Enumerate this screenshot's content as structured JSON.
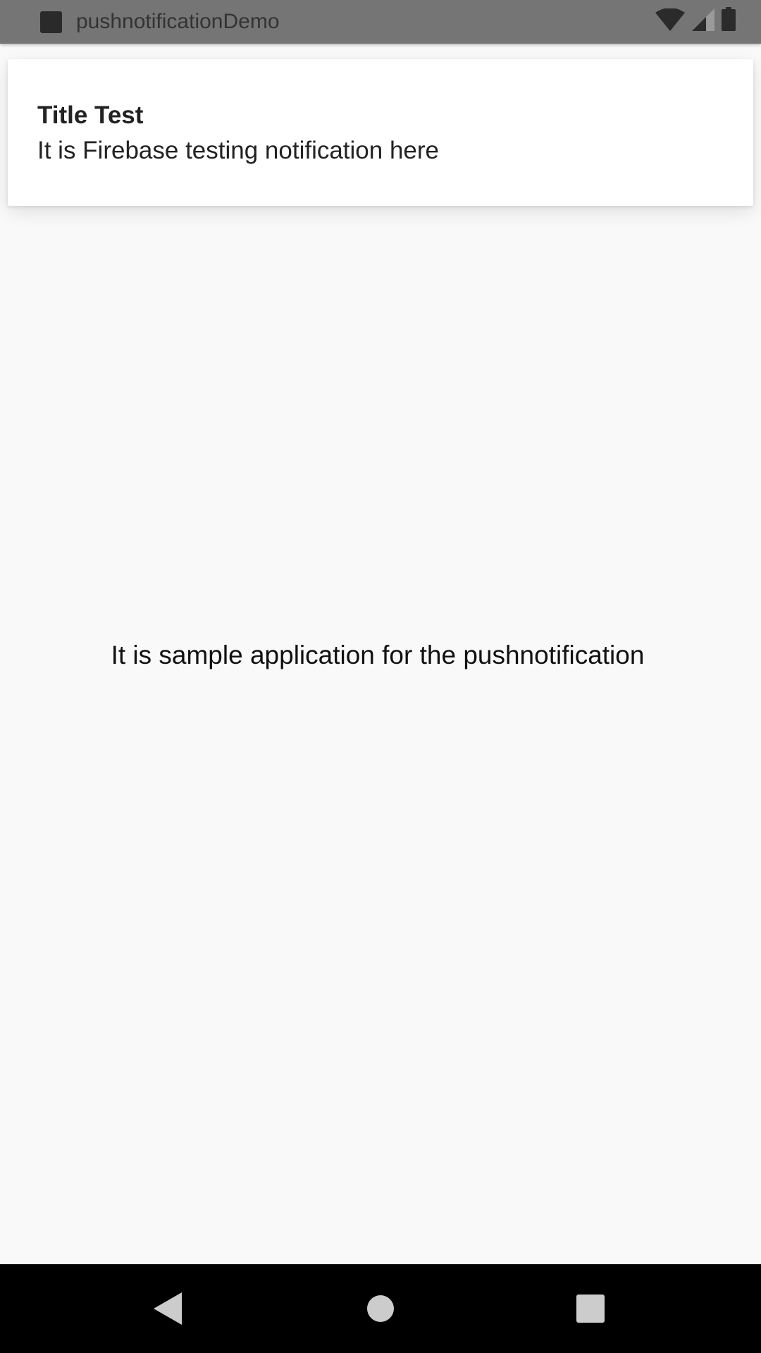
{
  "status_bar": {
    "app_name": "pushnotificationDemo",
    "icons": [
      "app-notification-icon",
      "wifi-icon",
      "signal-icon",
      "battery-icon"
    ],
    "background": "#757575"
  },
  "notification": {
    "title": "Title Test",
    "body": "It is Firebase testing notification here"
  },
  "main": {
    "text": "It is sample application for the pushnotification"
  },
  "nav_bar": {
    "buttons": [
      "back-icon",
      "home-icon",
      "recent-apps-icon"
    ]
  }
}
